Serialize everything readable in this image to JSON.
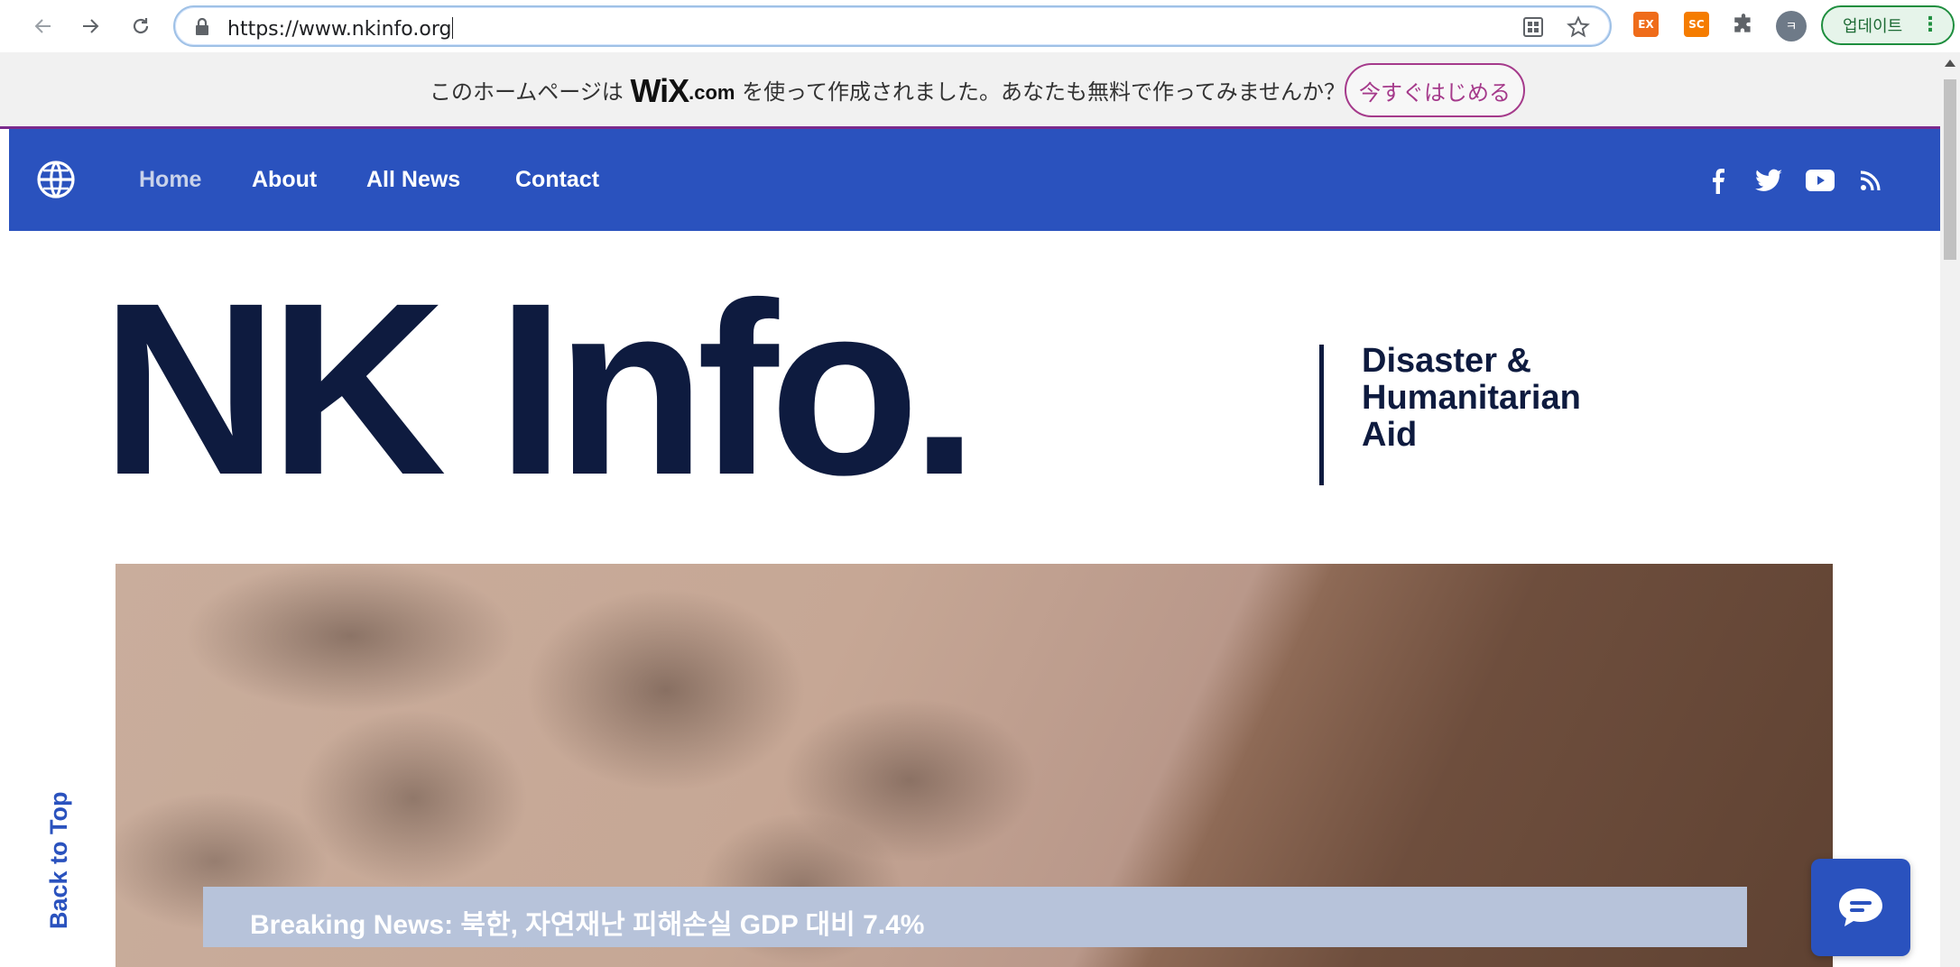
{
  "browser": {
    "url": "https://www.nkinfo.org",
    "profile_initial": "ㅋ",
    "update_label": "업데이트",
    "extensions": [
      {
        "label": "EX",
        "color": "#ef6c1a"
      },
      {
        "label": "SC",
        "color": "#f57c00"
      }
    ]
  },
  "wix_banner": {
    "text_before": "このホームページは",
    "logo": "WiX",
    "logo_suffix": ".com",
    "text_after": "を使って作成されました。あなたも無料で作ってみませんか？",
    "cta_label": "今すぐはじめる"
  },
  "nav": {
    "items": [
      {
        "label": "Home",
        "active": true
      },
      {
        "label": "About",
        "active": false
      },
      {
        "label": "All News",
        "active": false
      },
      {
        "label": "Contact",
        "active": false
      }
    ],
    "social": [
      "facebook-icon",
      "twitter-icon",
      "youtube-icon",
      "rss-icon"
    ]
  },
  "hero": {
    "brand": "NK Info.",
    "tagline_lines": [
      "Disaster &",
      "Humanitarian",
      "Aid"
    ],
    "breaking_news": "Breaking News: 북한, 자연재난 피해손실 GDP 대비 7.4%"
  },
  "back_to_top": "Back to Top",
  "colors": {
    "nav_bg": "#2a52be",
    "brand_text": "#0e1b3f",
    "wix_accent": "#a53a8b"
  }
}
